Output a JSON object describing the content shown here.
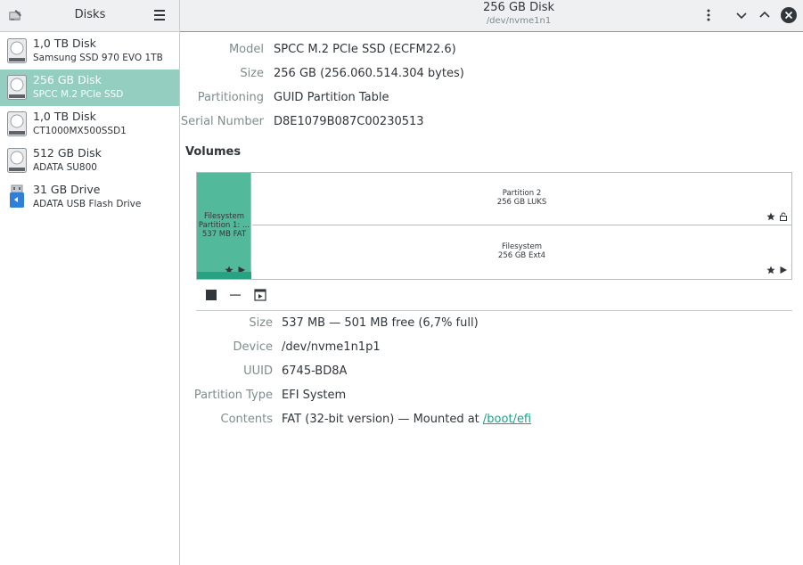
{
  "sidebar": {
    "title": "Disks",
    "drives": [
      {
        "name": "1,0 TB Disk",
        "model": "Samsung SSD 970 EVO 1TB",
        "icon": "hard-disk-icon"
      },
      {
        "name": "256 GB Disk",
        "model": "SPCC M.2 PCIe SSD",
        "icon": "hard-disk-icon",
        "selected": true
      },
      {
        "name": "1,0 TB Disk",
        "model": "CT1000MX500SSD1",
        "icon": "hard-disk-icon"
      },
      {
        "name": "512 GB Disk",
        "model": "ADATA SU800",
        "icon": "hard-disk-icon"
      },
      {
        "name": "31 GB Drive",
        "model": "ADATA USB Flash Drive",
        "icon": "usb-drive-icon"
      }
    ]
  },
  "header": {
    "title": "256 GB Disk",
    "subtitle": "/dev/nvme1n1"
  },
  "disk_info": {
    "model_label": "Model",
    "model": "SPCC M.2 PCIe SSD (ECFM22.6)",
    "size_label": "Size",
    "size": "256 GB (256.060.514.304 bytes)",
    "partitioning_label": "Partitioning",
    "partitioning": "GUID Partition Table",
    "serial_label": "Serial Number",
    "serial": "D8E1079B087C00230513"
  },
  "volumes": {
    "title": "Volumes",
    "partition1": {
      "line1": "Filesystem",
      "line2": "Partition 1: ...",
      "line3": "537 MB FAT"
    },
    "partition2": {
      "line1": "Partition 2",
      "line2": "256 GB LUKS"
    },
    "filesystem": {
      "line1": "Filesystem",
      "line2": "256 GB Ext4"
    }
  },
  "volume_info": {
    "size_label": "Size",
    "size": "537 MB — 501 MB free (6,7% full)",
    "device_label": "Device",
    "device": "/dev/nvme1n1p1",
    "uuid_label": "UUID",
    "uuid": "6745-BD8A",
    "ptype_label": "Partition Type",
    "ptype": "EFI System",
    "contents_label": "Contents",
    "contents_prefix": "FAT (32-bit version) — Mounted at ",
    "mount_point": "/boot/efi"
  },
  "colors": {
    "accent": "#3daee9",
    "selection": "#93cec1",
    "partition_fill": "#52b99a",
    "link": "#1aa387"
  }
}
